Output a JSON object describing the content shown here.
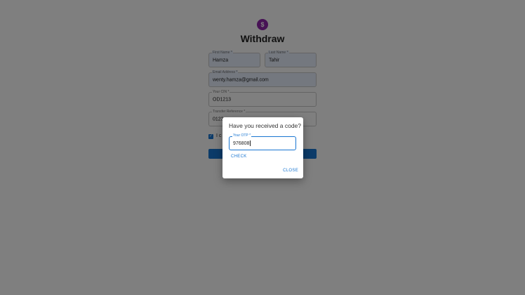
{
  "brand": {
    "logo_glyph": "$",
    "logo_color": "#8e24aa"
  },
  "form": {
    "title": "Withdraw",
    "first_name": {
      "label": "First Name *",
      "value": "Hamza"
    },
    "last_name": {
      "label": "Last Name *",
      "value": "Tahir"
    },
    "email": {
      "label": "Email Address *",
      "value": "wenty.hamza@gmail.com"
    },
    "cin": {
      "label": "Your CIN *",
      "value": "OD1213"
    },
    "transfer_ref": {
      "label": "Transfer Reference *",
      "value": "0123"
    },
    "agree_text": "I c",
    "checkbox_checked": true
  },
  "dialog": {
    "title": "Have you received a code?",
    "otp_label": "Your OTP *",
    "otp_value": "976808",
    "check_label": "CHECK",
    "close_label": "CLOSE"
  },
  "colors": {
    "primary": "#1976d2",
    "autofill_bg": "#e8f0fe"
  }
}
